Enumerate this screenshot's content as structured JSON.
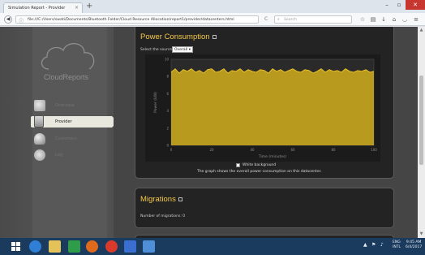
{
  "browser": {
    "tab_title": "Simulation Report - Provider",
    "tab_close": "×",
    "new_tab": "+",
    "url": "file:///C:/Users/swati/Documents/Bluetooth Folder/Cloud Resource Allocation/report1/provider/datacenters.html",
    "reload": "C",
    "search_placeholder": "Search",
    "window": {
      "minimize": "–",
      "maximize": "▫",
      "close": "✕"
    }
  },
  "sidebar": {
    "logo_text": "CloudReports",
    "items": [
      {
        "label": "Overview",
        "active": false
      },
      {
        "label": "Provider",
        "active": true
      },
      {
        "label": "Customers",
        "active": false
      },
      {
        "label": "Log",
        "active": false
      }
    ]
  },
  "power_panel": {
    "title": "Power Consumption",
    "source_label": "Select the source:",
    "source_value": "Overall",
    "background_label": "White background",
    "note": "The graph shows the overall power consumption on this datacenter."
  },
  "migrations_panel": {
    "title": "Migrations",
    "count_label": "Number of migrations: 0"
  },
  "taskbar": {
    "tray_arrow": "▲",
    "tray_flag": "⚑",
    "tray_sound": "♪",
    "lang_top": "ENG",
    "lang_bottom": "INTL",
    "time": "9:45 AM",
    "date": "6/4/2017"
  },
  "colors": {
    "accent": "#f3c94a",
    "chart_bar": "#b89a1e",
    "chart_line": "#f2c62c",
    "panel_bg": "#232323",
    "taskbar": "#1b3b5e",
    "close_button": "#c7372f"
  },
  "chart_data": {
    "type": "area",
    "title": "",
    "xlabel": "Time (minutes)",
    "ylabel": "Power (kW)",
    "xlim": [
      0,
      100
    ],
    "ylim": [
      0,
      10
    ],
    "x": [
      0,
      2,
      4,
      6,
      8,
      10,
      12,
      14,
      16,
      18,
      20,
      22,
      24,
      26,
      28,
      30,
      32,
      34,
      36,
      38,
      40,
      42,
      44,
      46,
      48,
      50,
      52,
      54,
      56,
      58,
      60,
      62,
      64,
      66,
      68,
      70,
      72,
      74,
      76,
      78,
      80,
      82,
      84,
      86,
      88,
      90,
      92,
      94,
      96,
      98,
      100
    ],
    "series": [
      {
        "values": [
          8.5,
          8.9,
          8.4,
          8.8,
          8.6,
          8.9,
          8.5,
          8.7,
          8.4,
          8.8,
          8.9,
          8.5,
          8.6,
          8.9,
          8.4,
          8.7,
          8.6,
          8.9,
          8.5,
          8.8,
          8.6,
          8.5,
          8.8,
          8.7,
          8.4,
          8.9,
          8.6,
          8.8,
          8.5,
          8.7,
          8.9,
          8.6,
          8.5,
          8.8,
          8.7,
          8.4,
          8.6,
          8.9,
          8.5,
          8.8,
          8.6,
          8.7,
          8.5,
          8.9,
          8.6,
          8.5,
          8.7,
          8.6,
          8.8,
          8.5,
          8.6
        ]
      }
    ],
    "grid": true
  }
}
